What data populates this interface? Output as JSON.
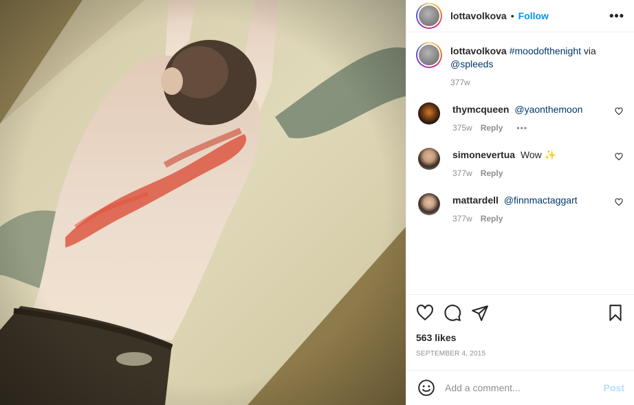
{
  "post": {
    "author": "lottavolkova",
    "separator": "•",
    "follow_label": "Follow",
    "more_label": "•••",
    "image_alt": "Photo of a shirtless person lying face-down on a floor with red marks across the back",
    "caption": {
      "username": "lottavolkova",
      "hashtag": "#moodofthenight",
      "via": "via",
      "mention": "@spleeds",
      "time": "377w"
    },
    "comments": [
      {
        "username": "thymcqueen",
        "text": "@yaonthemoon",
        "text_is_mention": true,
        "time": "375w",
        "reply_label": "Reply",
        "more": "•••"
      },
      {
        "username": "simonevertua",
        "text": "Wow ✨",
        "text_is_mention": false,
        "time": "377w",
        "reply_label": "Reply"
      },
      {
        "username": "mattardell",
        "text": "@finnmactaggart",
        "text_is_mention": true,
        "time": "377w",
        "reply_label": "Reply"
      }
    ],
    "likes": "563 likes",
    "date": "September 4, 2015",
    "add_comment_placeholder": "Add a comment...",
    "post_button": "Post"
  },
  "colors": {
    "accent": "#0095f6",
    "link": "#00376b",
    "muted": "#8e8e8e",
    "post_disabled": "#b2dffc"
  },
  "icons": [
    "heart-icon",
    "comment-icon",
    "share-icon",
    "bookmark-icon",
    "emoji-icon",
    "more-icon"
  ]
}
